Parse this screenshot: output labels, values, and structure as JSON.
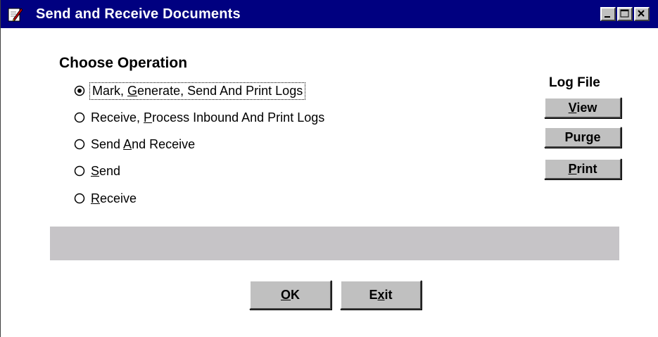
{
  "window": {
    "title": "Send and Receive Documents",
    "icons": {
      "app": "document-pen-icon",
      "minimize": "minimize-icon",
      "maximize": "maximize-icon",
      "close": "close-icon"
    }
  },
  "operation": {
    "heading": "Choose Operation",
    "selected_index": 0,
    "options": [
      {
        "pre": "Mark, ",
        "key": "G",
        "post": "enerate, Send And Print Logs",
        "checked": true
      },
      {
        "pre": "Receive, ",
        "key": "P",
        "post": "rocess Inbound And Print Logs",
        "checked": false
      },
      {
        "pre": "Send ",
        "key": "A",
        "post": "nd Receive",
        "checked": false
      },
      {
        "pre": "",
        "key": "S",
        "post": "end",
        "checked": false
      },
      {
        "pre": "",
        "key": "R",
        "post": "eceive",
        "checked": false
      }
    ]
  },
  "log_file": {
    "label": "Log File",
    "view": {
      "key": "V",
      "rest": "iew"
    },
    "purge": {
      "pre": "Purge"
    },
    "print": {
      "key": "P",
      "rest": "rint"
    }
  },
  "status": {
    "text": ""
  },
  "footer": {
    "ok": {
      "key": "O",
      "rest": "K"
    },
    "exit": {
      "pre": "E",
      "key": "x",
      "rest": "it"
    }
  },
  "colors": {
    "titlebar": "#000080",
    "button_face": "#c0c0c0",
    "status_bar": "#c6c4c7"
  }
}
